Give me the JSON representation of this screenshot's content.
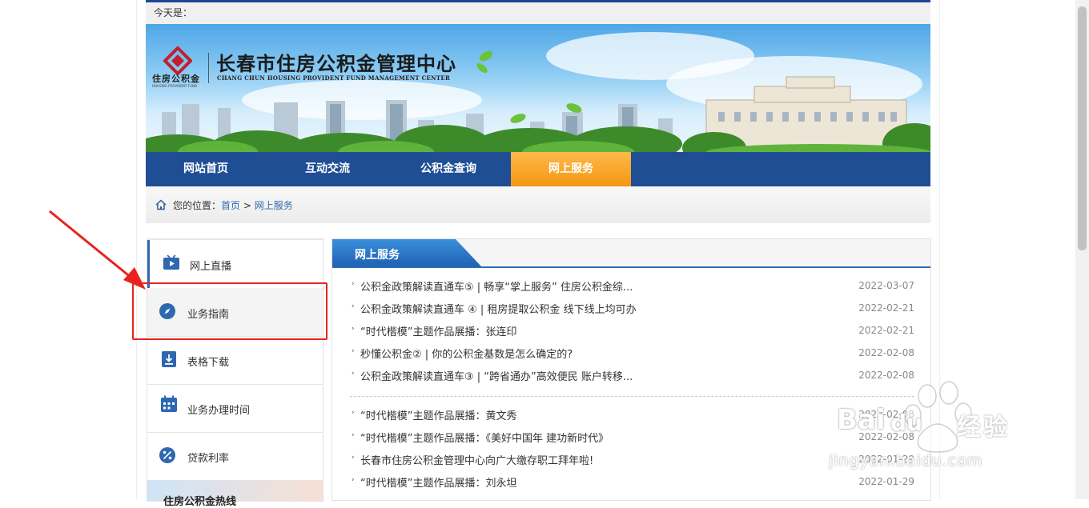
{
  "header": {
    "date_label": "今天是："
  },
  "logo": {
    "title": "长春市住房公积金管理中心",
    "subtitle_en": "CHANG CHUN HOUSING PROVIDENT FUND MANAGEMENT CENTER",
    "mark_label": "住房公积金",
    "mark_label_en": "HOUSING PROVIDENT FUND"
  },
  "nav": {
    "items": [
      {
        "label": "网站首页"
      },
      {
        "label": "互动交流"
      },
      {
        "label": "公积金查询"
      },
      {
        "label": "网上服务"
      }
    ],
    "active": "网上服务"
  },
  "breadcrumb": {
    "prefix": "您的位置：",
    "home": "首页",
    "sep": " > ",
    "current": "网上服务"
  },
  "sidebar": {
    "items": [
      {
        "label": "网上直播",
        "icon": "tv-icon"
      },
      {
        "label": "业务指南",
        "icon": "compass-icon"
      },
      {
        "label": "表格下载",
        "icon": "download-icon"
      },
      {
        "label": "业务办理时间",
        "icon": "calendar-icon"
      },
      {
        "label": "贷款利率",
        "icon": "percent-icon"
      }
    ],
    "hotline": "住房公积金热线"
  },
  "main": {
    "section_title": "网上服务",
    "news_top": [
      {
        "title": "公积金政策解读直通车⑤ | 畅享“掌上服务” 住房公积金综...",
        "date": "2022-03-07"
      },
      {
        "title": "公积金政策解读直通车 ④ | 租房提取公积金 线下线上均可办",
        "date": "2022-02-21"
      },
      {
        "title": "“时代楷模”主题作品展播：张连印",
        "date": "2022-02-21"
      },
      {
        "title": "秒懂公积金② | 你的公积金基数是怎么确定的?",
        "date": "2022-02-08"
      },
      {
        "title": "公积金政策解读直通车③ | “跨省通办”高效便民 账户转移...",
        "date": "2022-02-08"
      }
    ],
    "news_bottom": [
      {
        "title": "“时代楷模”主题作品展播：黄文秀",
        "date": "2022-02-08"
      },
      {
        "title": "“时代楷模”主题作品展播：《美好中国年 建功新时代》",
        "date": "2022-02-08"
      },
      {
        "title": "长春市住房公积金管理中心向广大缴存职工拜年啦!",
        "date": "2022-01-29"
      },
      {
        "title": "“时代楷模”主题作品展播：刘永坦",
        "date": "2022-01-29"
      }
    ]
  },
  "watermark": {
    "brand": "经验",
    "url": "jingyan.baidu.com",
    "bai": "Bai",
    "du": "du"
  },
  "colors": {
    "nav_bg": "#1f4e95",
    "nav_active": "#f39812",
    "link": "#2f6bb0",
    "highlight": "#e8231e"
  }
}
